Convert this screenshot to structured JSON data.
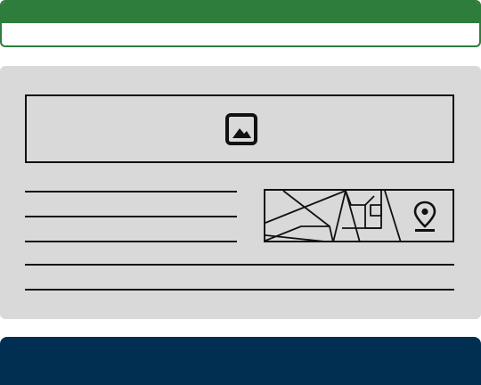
{
  "theme": {
    "header_color": "#2e7d3c",
    "card_color": "#d9d9d9",
    "stroke_color": "#111111",
    "footer_color": "#002f52"
  },
  "header": {
    "bar_icon": null
  },
  "card": {
    "hero_image": {
      "icon": "image-icon"
    },
    "text_lines_short": 3,
    "text_lines_full": 2,
    "map": {
      "icon": "map-pin-icon"
    }
  }
}
